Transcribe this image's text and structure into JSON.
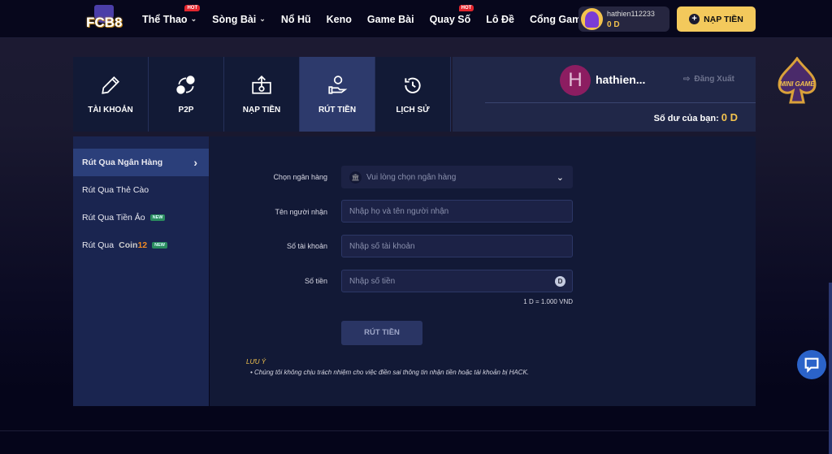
{
  "nav": {
    "logo": "FCB8",
    "items": [
      {
        "label": "Thể Thao",
        "dropdown": true,
        "hot": "HOT"
      },
      {
        "label": "Sòng Bài",
        "dropdown": true
      },
      {
        "label": "Nổ Hũ"
      },
      {
        "label": "Keno"
      },
      {
        "label": "Game Bài"
      },
      {
        "label": "Quay Số",
        "hot": "HOT"
      },
      {
        "label": "Lô Đề"
      },
      {
        "label": "Cổng Games",
        "dropdown": true
      }
    ],
    "user": {
      "username": "hathien112233",
      "balance": "0 D"
    },
    "deposit_label": "NẠP TIỀN"
  },
  "tabs": [
    {
      "label": "TÀI KHOẢN",
      "icon": "pencil-icon"
    },
    {
      "label": "P2P",
      "icon": "exchange-icon"
    },
    {
      "label": "NẠP TIỀN",
      "icon": "upload-money-icon"
    },
    {
      "label": "RÚT TIỀN",
      "icon": "hand-coin-icon",
      "active": true
    },
    {
      "label": "LỊCH SỬ",
      "icon": "history-icon"
    }
  ],
  "profile": {
    "avatar_letter": "H",
    "name": "hathien...",
    "logout": "Đăng Xuất",
    "balance_label": "Số dư của bạn:",
    "balance": "0 D"
  },
  "mini_game": "MINI GAME",
  "sidebar": [
    {
      "label": "Rút Qua Ngân Hàng",
      "active": true
    },
    {
      "label": "Rút Qua Thẻ Cào"
    },
    {
      "label": "Rút Qua Tiền Ảo",
      "badge": "NEW"
    },
    {
      "label": "Rút Qua",
      "brand": "Coin",
      "brand2": "12",
      "badge": "NEW"
    }
  ],
  "form": {
    "bank_label": "Chọn ngân hàng",
    "bank_placeholder": "Vui lòng chọn ngân hàng",
    "name_label": "Tên người nhận",
    "name_placeholder": "Nhập họ và tên người nhận",
    "account_label": "Số tài khoản",
    "account_placeholder": "Nhập số tài khoản",
    "amount_label": "Số tiền",
    "amount_placeholder": "Nhập số tiền",
    "currency": "D",
    "rate": "1 D = 1.000 VND",
    "submit": "RÚT TIỀN",
    "note_title": "LƯU Ý",
    "note": "Chúng tôi không chịu trách nhiệm cho việc điền sai thông tin nhận tiền hoặc tài khoản bị HACK."
  },
  "colors": {
    "accent": "#f3c34e",
    "active_tab": "#2d3a6c",
    "new_badge": "#2a8c5e",
    "chat": "#2b63c9"
  }
}
